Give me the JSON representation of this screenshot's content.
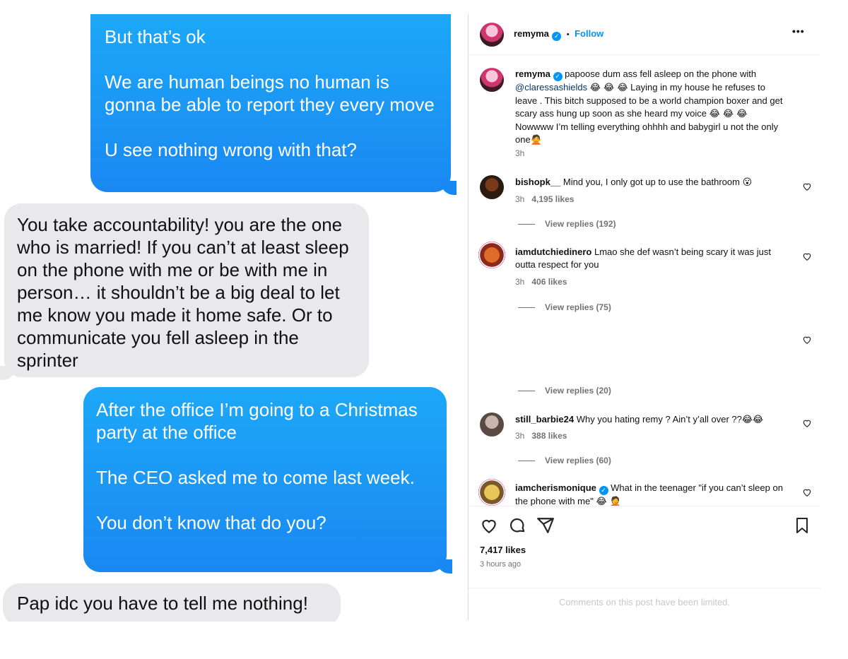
{
  "imessage": {
    "msg1": "But that’s ok\n\nWe are human beings no human is gonna be able to report they every move\n\nU see nothing wrong with that?",
    "msg2": "You take accountability! you are the one who is married! If you can’t at least sleep on the phone with me or be with me in person… it shouldn’t be a big deal to let me know you made it home safe. Or to communicate you fell asleep in the sprinter",
    "msg3": "After the office I’m going to a Christmas party at the office\n\nThe CEO asked me to come last week.\n\nYou don’t know that do you?",
    "msg4": "Pap idc you have to tell me nothing!",
    "colors": {
      "sent": "#1a88f2",
      "received": "#e9e9eb"
    }
  },
  "instagram": {
    "header": {
      "username": "remyma",
      "separator": "•",
      "follow": "Follow"
    },
    "caption": {
      "username": "remyma",
      "text_before": "papoose dum ass fell asleep on the phone with",
      "mention": "@claressashields",
      "emojis1": "😂 😂 😂",
      "text_after": "Laying in my house he refuses to leave . This bitch supposed to be a world champion boxer and get scary ass hung up soon as she heard my voice",
      "emojis2": "😂 😂 😂",
      "text_end": "Nowwww I’m telling everything ohhhh and babygirl u not the only one",
      "emoji3": "🙅",
      "time": "3h"
    },
    "comments": [
      {
        "username": "bishopk__",
        "text": "Mind you, I only got up to use the bathroom",
        "emoji": "😮",
        "time": "3h",
        "likes": "4,195 likes",
        "replies": "View replies (192)"
      },
      {
        "username": "iamdutchiedinero",
        "text": "Lmao she def wasn’t being scary it was just outta respect for you",
        "emoji": "",
        "time": "3h",
        "likes": "406 likes",
        "replies": "View replies (75)"
      },
      {
        "username": "",
        "text": "",
        "emoji": "",
        "time": "",
        "likes": "",
        "replies": "View replies (20)"
      },
      {
        "username": "still_barbie24",
        "text": "Why you hating remy ? Ain’t y’all over ??",
        "emoji": "😂😂",
        "time": "3h",
        "likes": "388 likes",
        "replies": "View replies (60)"
      },
      {
        "username": "iamcherismonique",
        "text": "What in the teenager \"if you can’t sleep on the phone with me\"",
        "emoji": "😂 🤦",
        "time": "",
        "likes": "",
        "replies": ""
      }
    ],
    "likes": "7,417 likes",
    "posted": "3 hours ago",
    "limited": "Comments on this post have been limited.",
    "more": "•••"
  }
}
